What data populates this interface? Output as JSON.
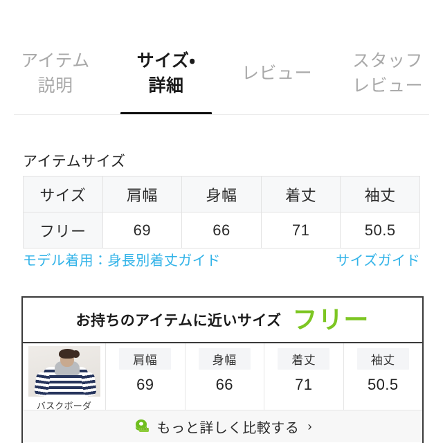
{
  "tabs": [
    {
      "id": "item-description",
      "lines": [
        "アイテム",
        "説明"
      ],
      "active": false
    },
    {
      "id": "size-detail",
      "lines": [
        "サイズ・",
        "詳細"
      ],
      "active": true
    },
    {
      "id": "review",
      "lines": [
        "レビュー"
      ],
      "active": false
    },
    {
      "id": "staff-review",
      "lines": [
        "スタッフ",
        "レビュー"
      ],
      "active": false
    }
  ],
  "item_size": {
    "title": "アイテムサイズ",
    "columns": [
      "サイズ",
      "肩幅",
      "身幅",
      "着丈",
      "袖丈"
    ],
    "rows": [
      [
        "フリー",
        "69",
        "66",
        "71",
        "50.5"
      ]
    ]
  },
  "links": {
    "model_guide": "モデル着用：身長別着丈ガイド",
    "size_guide": "サイズガイド",
    "color": "#32b3e8"
  },
  "compare_card": {
    "heading_label": "お持ちのアイテムに近いサイズ",
    "heading_size": "フリー",
    "heading_size_color": "#7dc623",
    "thumbnail_caption": "バスクボーダ",
    "measures": [
      {
        "label": "肩幅",
        "value": "69"
      },
      {
        "label": "身幅",
        "value": "66"
      },
      {
        "label": "着丈",
        "value": "71"
      },
      {
        "label": "袖丈",
        "value": "50.5"
      }
    ],
    "footer_label": "もっと詳しく比較する",
    "footer_chevron": "›",
    "footer_icon": "measuring-tape-icon"
  }
}
